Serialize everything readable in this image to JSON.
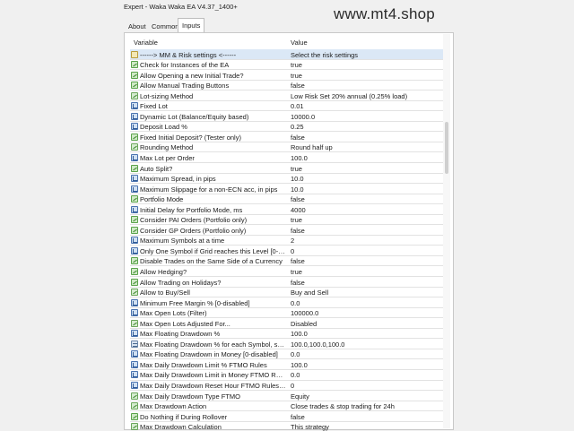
{
  "window": {
    "title": "Expert - Waka Waka EA V4.37_1400+"
  },
  "watermark": "www.mt4.shop",
  "tabs": [
    {
      "label": "About",
      "active": false
    },
    {
      "label": "Common",
      "active": false
    },
    {
      "label": "Inputs",
      "active": true
    }
  ],
  "table": {
    "headers": {
      "variable": "Variable",
      "value": "Value"
    },
    "rows": [
      {
        "name": "------> MM & Risk settings <------",
        "value": "Select the risk settings",
        "icon": "separator-icon",
        "type": "sep",
        "selected": true
      },
      {
        "name": "Check for Instances of the EA",
        "value": "true",
        "icon": "bool-icon",
        "type": "bool"
      },
      {
        "name": "Allow Opening a new Initial Trade?",
        "value": "true",
        "icon": "bool-icon",
        "type": "bool"
      },
      {
        "name": "Allow Manual Trading Buttons",
        "value": "false",
        "icon": "bool-icon",
        "type": "bool"
      },
      {
        "name": "Lot-sizing Method",
        "value": "Low Risk Set 20% annual (0.25% load)",
        "icon": "enum-icon",
        "type": "enum"
      },
      {
        "name": "Fixed Lot",
        "value": "0.01",
        "icon": "number-icon",
        "type": "num"
      },
      {
        "name": "Dynamic Lot (Balance/Equity based)",
        "value": "10000.0",
        "icon": "number-icon",
        "type": "num"
      },
      {
        "name": "Deposit Load %",
        "value": "0.25",
        "icon": "number-icon",
        "type": "num"
      },
      {
        "name": "Fixed Initial Deposit? (Tester only)",
        "value": "false",
        "icon": "bool-icon",
        "type": "bool"
      },
      {
        "name": "Rounding Method",
        "value": "Round half up",
        "icon": "enum-icon",
        "type": "enum"
      },
      {
        "name": "Max Lot per Order",
        "value": "100.0",
        "icon": "number-icon",
        "type": "num"
      },
      {
        "name": "Auto Split?",
        "value": "true",
        "icon": "bool-icon",
        "type": "bool"
      },
      {
        "name": "Maximum Spread, in pips",
        "value": "10.0",
        "icon": "number-icon",
        "type": "num"
      },
      {
        "name": "Maximum Slippage for a non-ECN acc, in pips",
        "value": "10.0",
        "icon": "number-icon",
        "type": "num"
      },
      {
        "name": "Portfolio Mode",
        "value": "false",
        "icon": "bool-icon",
        "type": "bool"
      },
      {
        "name": "Initial Delay for Portfolio Mode, ms",
        "value": "4000",
        "icon": "number-icon",
        "type": "num"
      },
      {
        "name": "Consider PAI Orders (Portfolio only)",
        "value": "true",
        "icon": "bool-icon",
        "type": "bool"
      },
      {
        "name": "Consider GP Orders (Portfolio only)",
        "value": "false",
        "icon": "bool-icon",
        "type": "bool"
      },
      {
        "name": "Maximum Symbols at a time",
        "value": "2",
        "icon": "number-icon",
        "type": "num"
      },
      {
        "name": "Only One Symbol if Grid reaches this Level [0-di...",
        "value": "0",
        "icon": "number-icon",
        "type": "num"
      },
      {
        "name": "Disable Trades on the Same Side of a Currency",
        "value": "false",
        "icon": "bool-icon",
        "type": "bool"
      },
      {
        "name": "Allow Hedging?",
        "value": "true",
        "icon": "bool-icon",
        "type": "bool"
      },
      {
        "name": "Allow Trading on Holidays?",
        "value": "false",
        "icon": "bool-icon",
        "type": "bool"
      },
      {
        "name": "Allow to Buy/Sell",
        "value": "Buy and Sell",
        "icon": "enum-icon",
        "type": "enum"
      },
      {
        "name": "Minimum Free Margin % [0-disabled]",
        "value": "0.0",
        "icon": "number-icon",
        "type": "num"
      },
      {
        "name": "Max Open Lots (Filter)",
        "value": "100000.0",
        "icon": "number-icon",
        "type": "num"
      },
      {
        "name": "Max Open Lots Adjusted For...",
        "value": "Disabled",
        "icon": "enum-icon",
        "type": "enum"
      },
      {
        "name": "Max Floating Drawdown %",
        "value": "100.0",
        "icon": "number-icon",
        "type": "num"
      },
      {
        "name": "Max Floating Drawdown % for each Symbol, sep...",
        "value": "100.0,100.0,100.0",
        "icon": "text-icon",
        "type": "text"
      },
      {
        "name": "Max Floating Drawdown in Money [0-disabled]",
        "value": "0.0",
        "icon": "number-icon",
        "type": "num"
      },
      {
        "name": "Max Daily Drawdown Limit % FTMO Rules",
        "value": "100.0",
        "icon": "number-icon",
        "type": "num"
      },
      {
        "name": "Max Daily Drawdown Limit in Money FTMO Rule...",
        "value": "0.0",
        "icon": "number-icon",
        "type": "num"
      },
      {
        "name": "Max Daily Drawdown Reset Hour FTMO Rules (B...",
        "value": "0",
        "icon": "number-icon",
        "type": "num"
      },
      {
        "name": "Max Daily Drawdown Type FTMO",
        "value": "Equity",
        "icon": "enum-icon",
        "type": "enum"
      },
      {
        "name": "Max Drawdown Action",
        "value": "Close trades & stop trading for 24h",
        "icon": "enum-icon",
        "type": "enum"
      },
      {
        "name": "Do Nothing if During Rollover",
        "value": "false",
        "icon": "bool-icon",
        "type": "bool"
      },
      {
        "name": "Max Drawdown Calculation",
        "value": "This strategy",
        "icon": "enum-icon",
        "type": "enum"
      }
    ]
  }
}
